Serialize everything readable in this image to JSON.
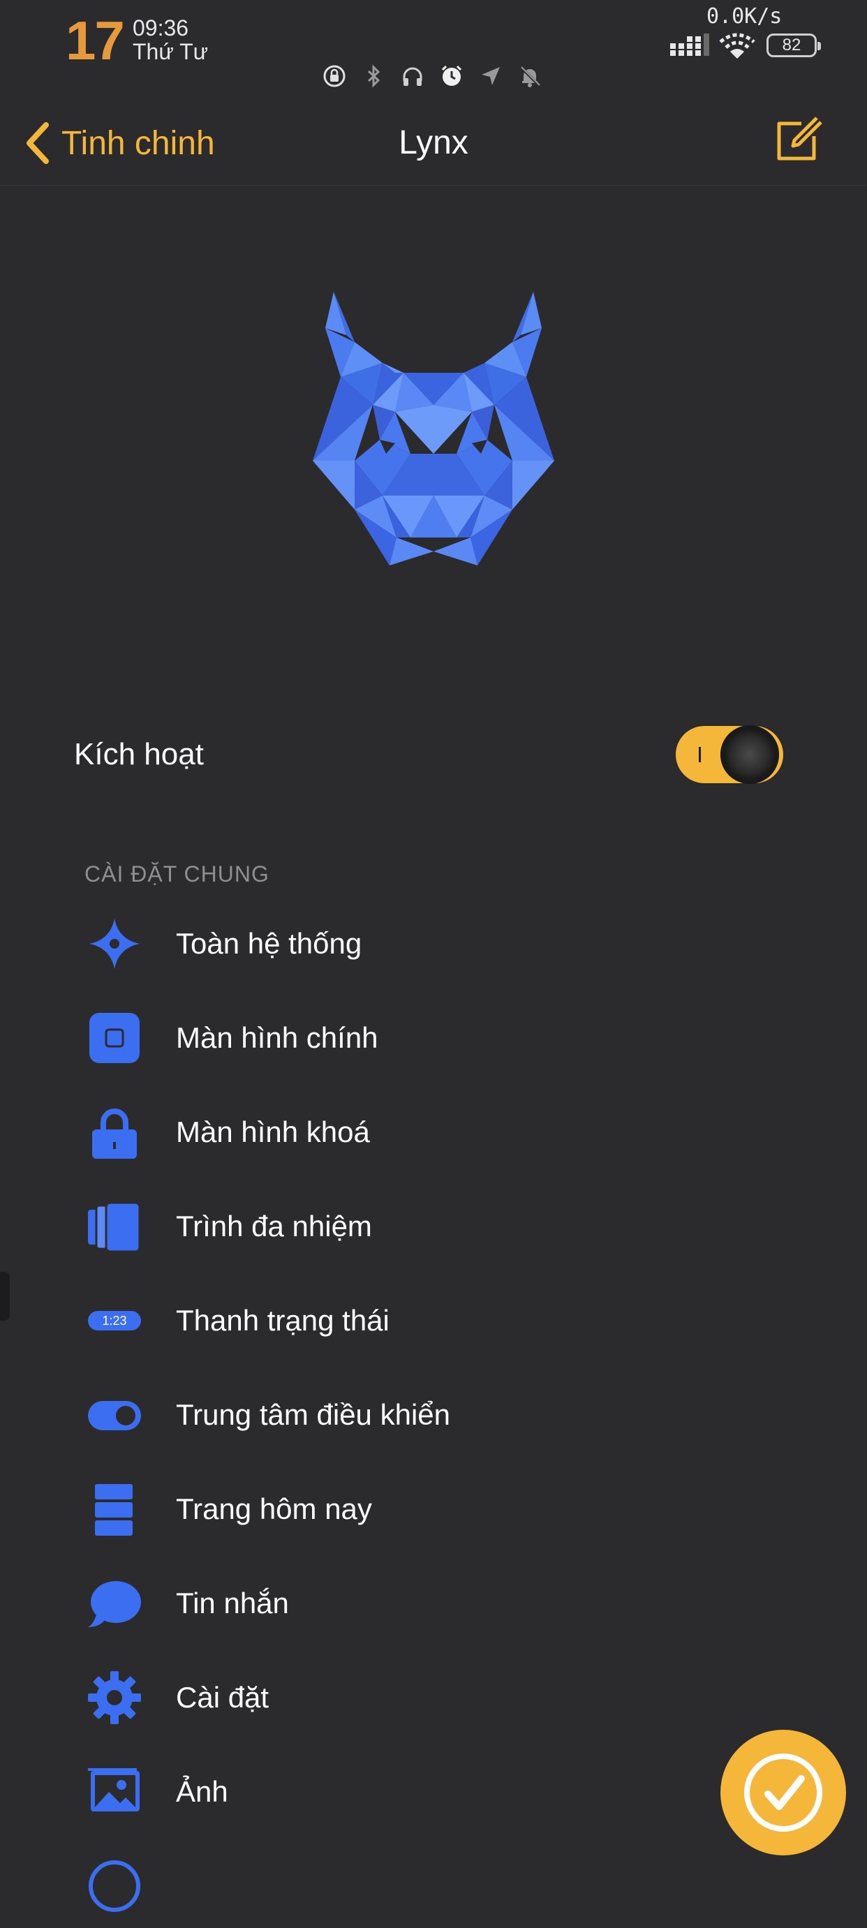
{
  "status_bar": {
    "day": "17",
    "time": "09:36",
    "weekday": "Thứ Tư",
    "net_speed": "0.0K/s",
    "battery": "82",
    "icons": [
      "orientation-lock-icon",
      "bluetooth-icon",
      "headphones-icon",
      "alarm-icon",
      "location-icon",
      "silent-icon"
    ]
  },
  "nav": {
    "back_label": "Tinh chinh",
    "title": "Lynx",
    "edit_icon": "edit-icon"
  },
  "colors": {
    "accent": "#f5b73a",
    "icon_blue": "#3b6ef0",
    "background": "#2b2b2d"
  },
  "toggle": {
    "label": "Kích hoạt",
    "on": true
  },
  "section": {
    "title": "CÀI ĐẶT CHUNG",
    "items": [
      {
        "label": "Toàn hệ thống",
        "icon": "sparkle-icon"
      },
      {
        "label": "Màn hình chính",
        "icon": "home-screen-icon"
      },
      {
        "label": "Màn hình khoá",
        "icon": "lock-icon"
      },
      {
        "label": "Trình đa nhiệm",
        "icon": "multitasking-icon"
      },
      {
        "label": "Thanh trạng thái",
        "icon": "status-bar-icon",
        "icon_text": "1:23"
      },
      {
        "label": "Trung tâm điều khiển",
        "icon": "toggle-icon"
      },
      {
        "label": "Trang hôm nay",
        "icon": "widgets-icon"
      },
      {
        "label": "Tin nhắn",
        "icon": "message-icon"
      },
      {
        "label": "Cài đặt",
        "icon": "gear-icon"
      },
      {
        "label": "Ảnh",
        "icon": "photos-icon"
      }
    ]
  },
  "fab": {
    "icon": "checkmark-icon"
  }
}
